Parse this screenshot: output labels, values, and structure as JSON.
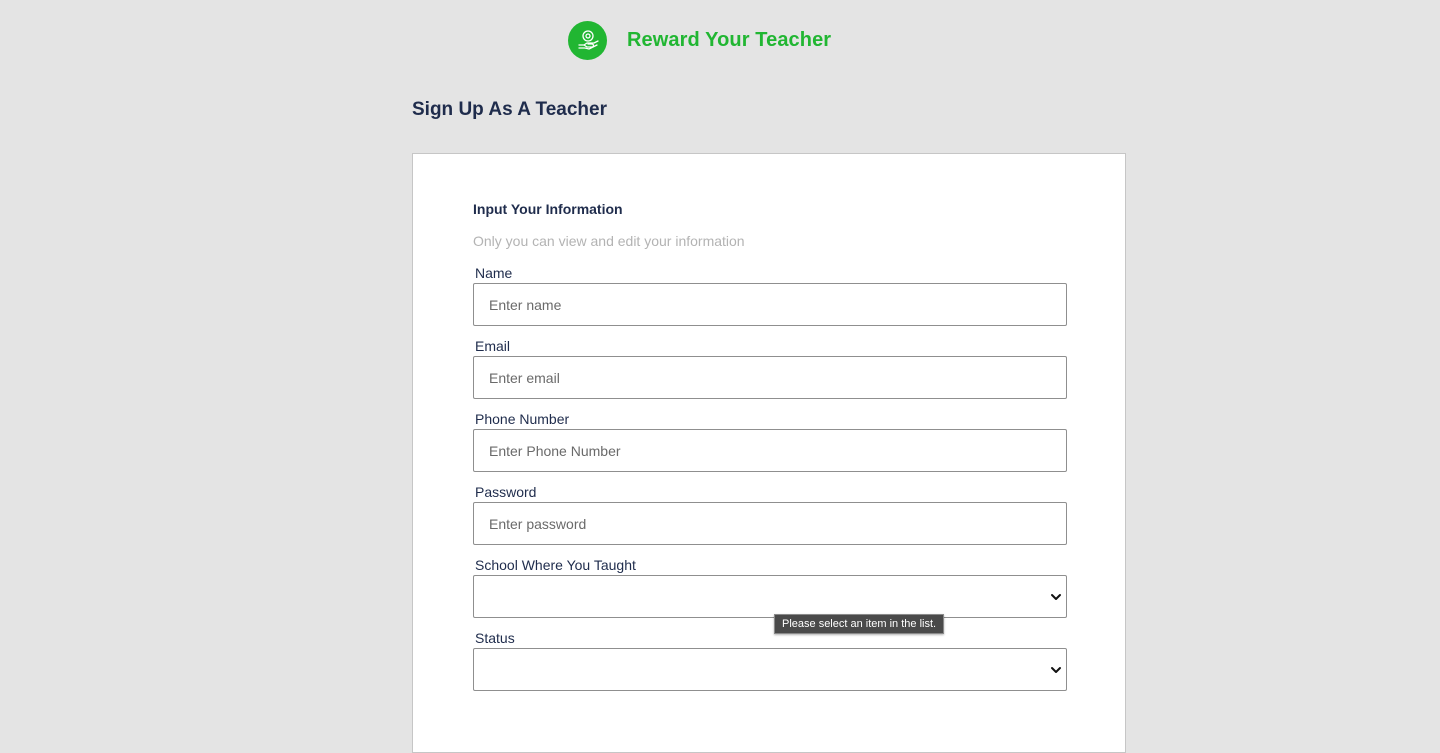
{
  "brand": {
    "name": "Reward Your Teacher",
    "color": "#21b632",
    "icon": "hand-coin-icon"
  },
  "page": {
    "title": "Sign Up As A Teacher"
  },
  "form": {
    "section_title": "Input Your Information",
    "section_subtitle": "Only you can view and edit your information",
    "fields": [
      {
        "label": "Name",
        "placeholder": "Enter name",
        "value": ""
      },
      {
        "label": "Email",
        "placeholder": "Enter email",
        "value": ""
      },
      {
        "label": "Phone Number",
        "placeholder": "Enter Phone Number",
        "value": ""
      },
      {
        "label": "Password",
        "placeholder": "Enter password",
        "value": ""
      }
    ],
    "selects": [
      {
        "label": "School Where You Taught",
        "selected": ""
      },
      {
        "label": "Status",
        "selected": ""
      }
    ]
  },
  "validation_tooltip": "Please select an item in the list."
}
